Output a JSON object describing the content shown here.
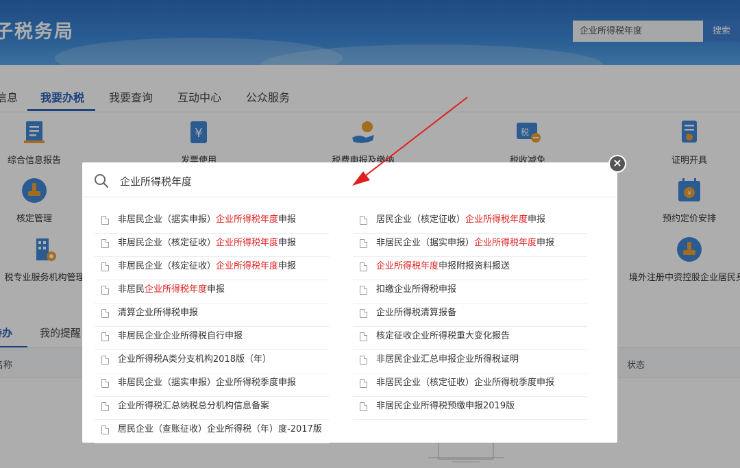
{
  "header": {
    "site_title": "务局",
    "site_title_visible": "子税务局",
    "search_value": "企业所得税年度",
    "search_button": "搜索"
  },
  "nav": {
    "items": [
      "信息",
      "我要办税",
      "我要查询",
      "互动中心",
      "公众服务"
    ],
    "active_index": 1
  },
  "services": {
    "row1": [
      "综合信息报告",
      "发票使用",
      "税费申报及缴纳",
      "税收减免",
      "证明开具"
    ],
    "row2_left": "核定管理",
    "row2_right": "预约定价安排",
    "row3_left": "税专业服务机构管理",
    "row3_right": "境外注册中资控股企业居民身份"
  },
  "todo": {
    "tabs": [
      "待办",
      "我的提醒"
    ],
    "col_name": "名称",
    "col_status": "状态"
  },
  "modal": {
    "query": "企业所得税年度",
    "left_results": [
      {
        "pre": "非居民企业（据实申报）",
        "hl": "企业所得税年度",
        "post": "申报"
      },
      {
        "pre": "非居民企业（核定征收）",
        "hl": "企业所得税年度",
        "post": "申报"
      },
      {
        "pre": "非居民企业（核定征收）",
        "hl": "企业所得税年度",
        "post": "申报"
      },
      {
        "pre": "非居民",
        "hl": "企业所得税年度",
        "post": "申报"
      },
      {
        "pre": "清算企业所得税申报",
        "hl": "",
        "post": ""
      },
      {
        "pre": "非居民企业企业所得税自行申报",
        "hl": "",
        "post": ""
      },
      {
        "pre": "企业所得税A类分支机构2018版（年）",
        "hl": "",
        "post": ""
      },
      {
        "pre": "非居民企业（据实申报）企业所得税季度申报",
        "hl": "",
        "post": ""
      },
      {
        "pre": "企业所得税汇总纳税总分机构信息备案",
        "hl": "",
        "post": ""
      },
      {
        "pre": "居民企业（查账征收）企业所得税（年）度-2017版",
        "hl": "",
        "post": ""
      }
    ],
    "right_results": [
      {
        "pre": "居民企业（核定征收）",
        "hl": "企业所得税年度",
        "post": "申报"
      },
      {
        "pre": "非居民企业（据实申报）",
        "hl": "企业所得税年度",
        "post": "申报"
      },
      {
        "pre": "",
        "hl": "企业所得税年度",
        "post": "申报附报资料报送"
      },
      {
        "pre": "扣缴企业所得税申报",
        "hl": "",
        "post": ""
      },
      {
        "pre": "企业所得税清算报备",
        "hl": "",
        "post": ""
      },
      {
        "pre": "核定征收企业所得税重大变化报告",
        "hl": "",
        "post": ""
      },
      {
        "pre": "非居民企业汇总申报企业所得税证明",
        "hl": "",
        "post": ""
      },
      {
        "pre": "非居民企业（核定征收）企业所得税季度申报",
        "hl": "",
        "post": ""
      },
      {
        "pre": "非居民企业所得税预缴申报2019版",
        "hl": "",
        "post": ""
      }
    ]
  },
  "colors": {
    "brand_blue": "#2a63b8",
    "highlight_red": "#e02020",
    "annotation_arrow": "#e02020"
  }
}
